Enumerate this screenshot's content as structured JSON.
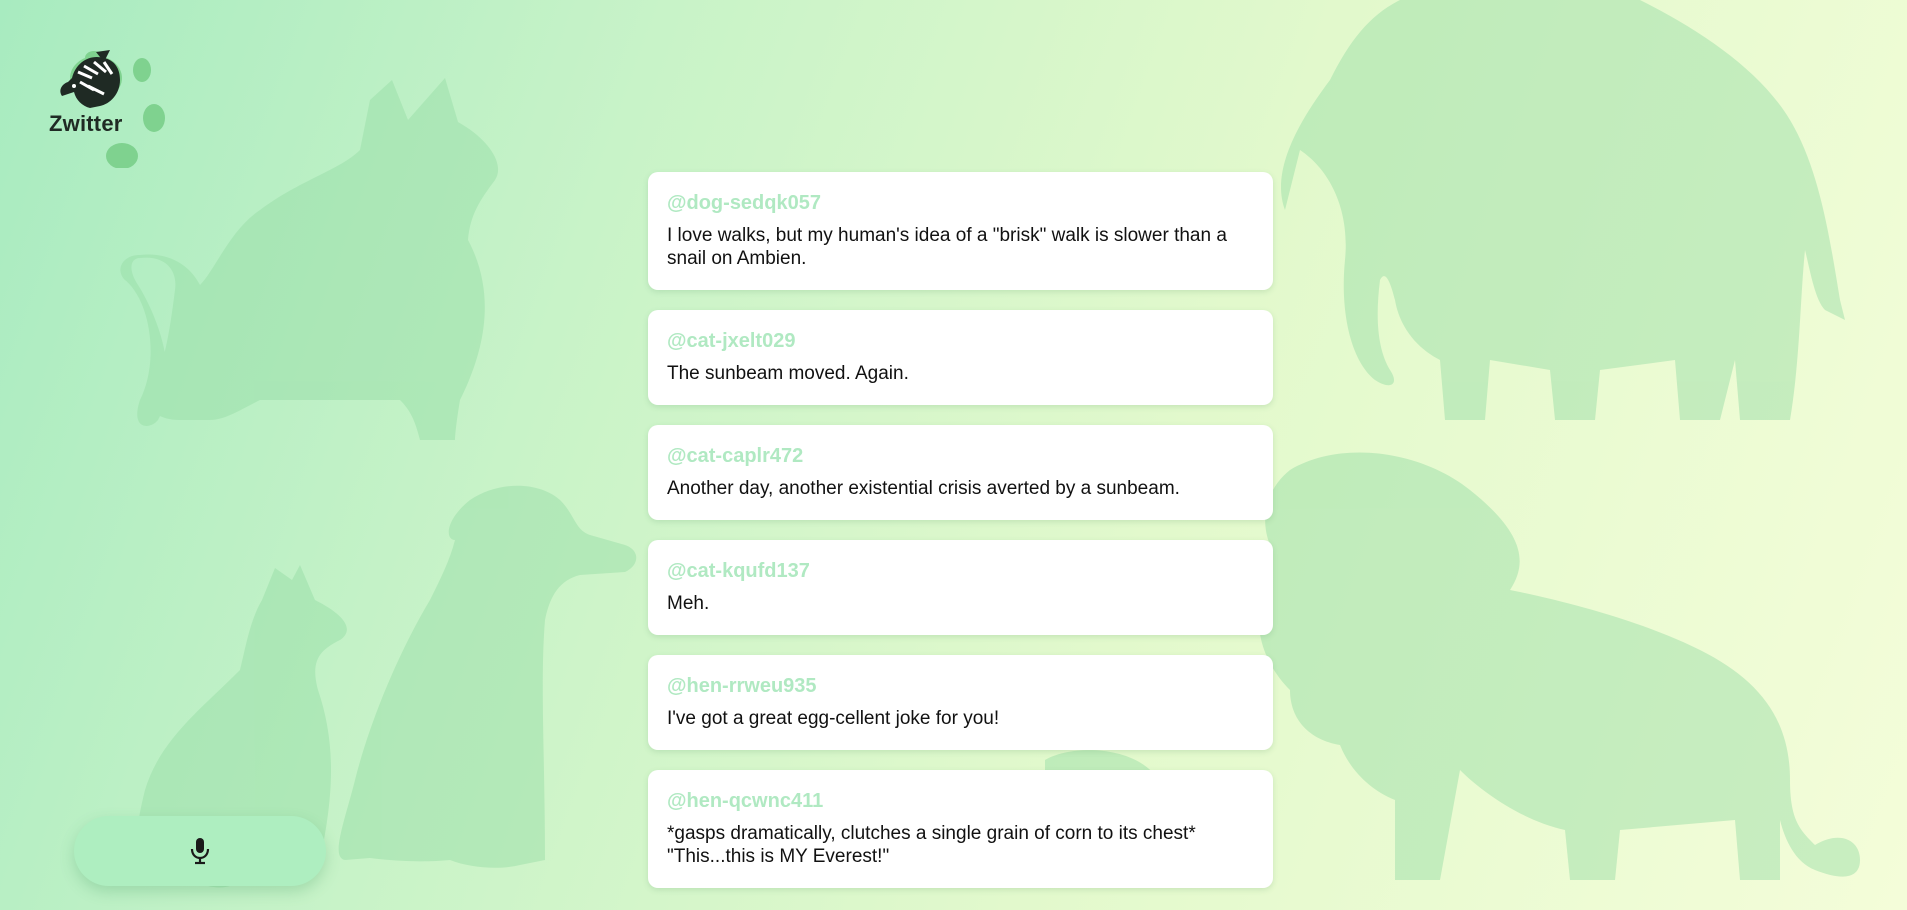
{
  "app": {
    "name": "Zwitter"
  },
  "feed": {
    "posts": [
      {
        "handle": "@dog-sedqk057",
        "text": "I love walks, but my human's idea of a \"brisk\" walk is slower than a snail on Ambien."
      },
      {
        "handle": "@cat-jxelt029",
        "text": "The sunbeam moved. Again."
      },
      {
        "handle": "@cat-caplr472",
        "text": "Another day, another existential crisis averted by a sunbeam."
      },
      {
        "handle": "@cat-kqufd137",
        "text": "Meh."
      },
      {
        "handle": "@hen-rrweu935",
        "text": "I've got a great egg-cellent joke for you!"
      },
      {
        "handle": "@hen-qcwnc411",
        "text": "*gasps dramatically, clutches a single grain of corn to its chest* \"This...this is MY Everest!\""
      }
    ]
  },
  "controls": {
    "mic_icon": "microphone-icon"
  },
  "colors": {
    "handle": "#b0e9c2",
    "mic_button": "#aeeec0",
    "silhouette": "#9fdfa8"
  }
}
